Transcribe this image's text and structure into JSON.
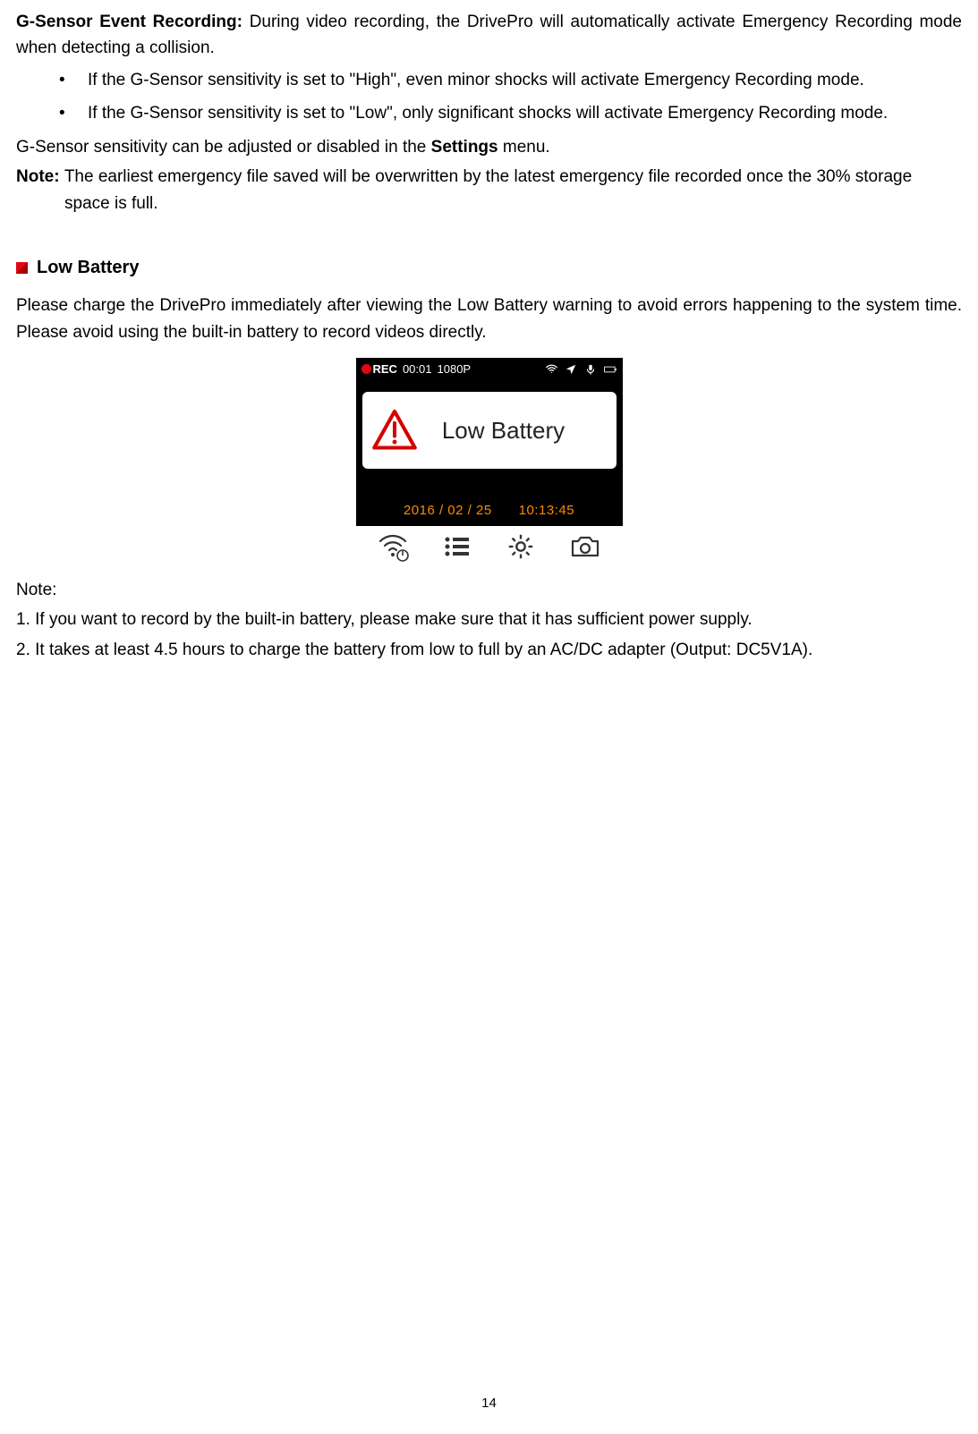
{
  "section1": {
    "heading_bold": "G-Sensor Event Recording: ",
    "heading_rest": "During video recording, the DrivePro will automatically activate Emergency Recording mode when detecting a collision.",
    "bullets": [
      "If the G-Sensor sensitivity is set to \"High\", even minor shocks will activate Emergency Recording mode.",
      "If the G-Sensor sensitivity is set to \"Low\", only significant shocks will activate Emergency Recording mode."
    ],
    "adjust_pre": "G-Sensor sensitivity can be adjusted or disabled in the ",
    "adjust_bold": "Settings",
    "adjust_post": " menu.",
    "note_bold": "Note: ",
    "note_rest": "The earliest emergency file saved will be overwritten by the latest emergency file recorded once the 30% storage space is full."
  },
  "section2": {
    "title": "Low Battery",
    "intro": "Please charge the DrivePro immediately after viewing the Low Battery warning to avoid errors happening to the system time. Please avoid using the built-in battery to record videos directly.",
    "note_label": "Note:",
    "note1": "1. If you want to record by the built-in battery, please make sure that it has sufficient power supply.",
    "note2": "2. It takes at least 4.5 hours to charge the battery from low to full by an AC/DC adapter (Output: DC5V1A)."
  },
  "screenshot": {
    "rec_label": "REC",
    "rec_time": "00:01",
    "resolution": "1080P",
    "dialog_text": "Low Battery",
    "date": "2016 / 02 / 25",
    "time": "10:13:45"
  },
  "page_number": "14"
}
